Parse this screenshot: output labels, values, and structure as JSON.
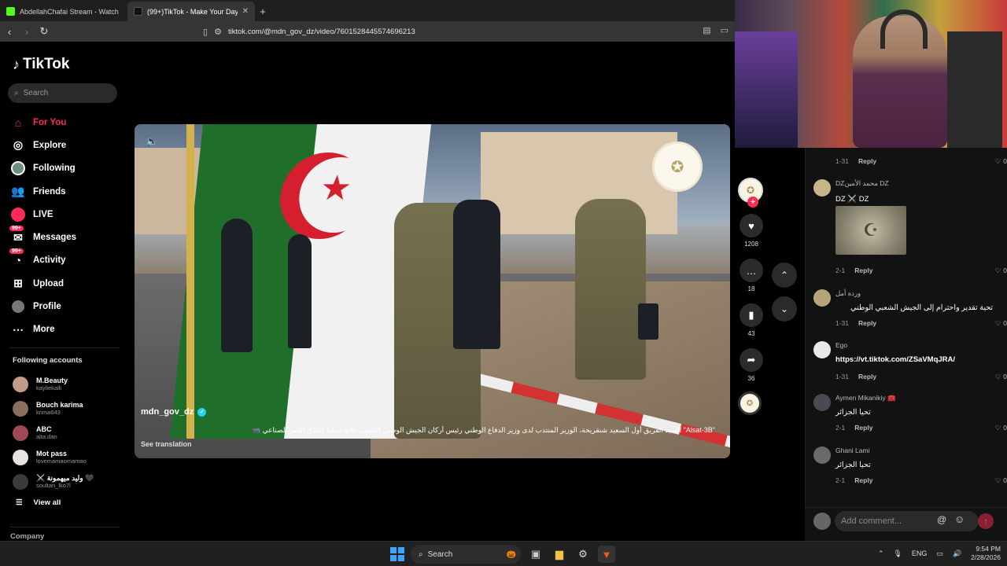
{
  "browser": {
    "tabs": [
      {
        "title": "AbdellahChafai Stream - Watch Live...",
        "active": false,
        "favicon_color": "#53fc18"
      },
      {
        "title": "(99+)TikTok - Make Your Day",
        "active": true,
        "favicon_color": "#000000"
      }
    ],
    "url": "tiktok.com/@mdn_gov_dz/video/7601528445574696213"
  },
  "sidebar": {
    "logo": "TikTok",
    "search_placeholder": "Search",
    "nav": [
      {
        "label": "For You",
        "icon": "home-icon",
        "active": true
      },
      {
        "label": "Explore",
        "icon": "compass-icon",
        "active": false
      },
      {
        "label": "Following",
        "icon": "following-avatar-icon",
        "active": false
      },
      {
        "label": "Friends",
        "icon": "friends-icon",
        "active": false
      },
      {
        "label": "LIVE",
        "icon": "live-icon",
        "active": false
      },
      {
        "label": "Messages",
        "icon": "messages-icon",
        "badge": "99+",
        "active": false
      },
      {
        "label": "Activity",
        "icon": "activity-icon",
        "badge": "99+",
        "active": false
      },
      {
        "label": "Upload",
        "icon": "upload-icon",
        "active": false
      },
      {
        "label": "Profile",
        "icon": "profile-icon",
        "active": false
      },
      {
        "label": "More",
        "icon": "more-icon",
        "active": false
      }
    ],
    "following_title": "Following accounts",
    "accounts": [
      {
        "name": "M.Beauty",
        "handle": "kayliekalli",
        "color": "#c49a8a"
      },
      {
        "name": "Bouch karima",
        "handle": "krima643",
        "color": "#8a6d5a"
      },
      {
        "name": "ABC",
        "handle": "alta.dan",
        "color": "#9e4a55"
      },
      {
        "name": "Mot pass",
        "handle": "lovemamaomamao",
        "color": "#e8e3dc"
      },
      {
        "name": "⚔️ وليد ميهمونة 🖤",
        "handle": "soultan_lko7l",
        "color": "#3b3b3b"
      }
    ],
    "view_all": "View all",
    "company": "Company"
  },
  "video": {
    "username": "mdn_gov_dz",
    "caption": "\"Alsat-3B\" السيد الفريق أول السعيد شنقريحة، الوزير المنتدب لدى وزير الدفاع الوطني رئيس أركان الجيش الوطني الشعبي يتابع عملية إطلاق القمر الصناعي 📹",
    "see_translation": "See translation"
  },
  "actions": {
    "likes": "1208",
    "comments": "18",
    "saves": "43",
    "shares": "36"
  },
  "comments": [
    {
      "name": "",
      "text": "",
      "date": "1-31",
      "reply": "Reply",
      "likes": "0",
      "color": "#555"
    },
    {
      "name": "DZمحمد الأمين DZ",
      "text": "DZ ⚔️ DZ",
      "date": "2-1",
      "reply": "Reply",
      "likes": "0",
      "color": "#c7b58a",
      "sticker": true
    },
    {
      "name": "وردة أمل",
      "text": "تحية تقدير واحترام إلى الجيش الشعبي الوطني",
      "date": "1-31",
      "reply": "Reply",
      "likes": "0",
      "color": "#b6a47a",
      "rtl": true
    },
    {
      "name": "Ego",
      "text": "https://vt.tiktok.com/ZSaVMqJRA/",
      "date": "1-31",
      "reply": "Reply",
      "likes": "0",
      "color": "#e8e8e8",
      "link": true
    },
    {
      "name": "Aymen Mikanikiy 🧰",
      "text": "تحيا الجزائر",
      "date": "2-1",
      "reply": "Reply",
      "likes": "0",
      "color": "#4a4a55",
      "rtl": true
    },
    {
      "name": "Ghani Lami",
      "text": "تحيا الجزائر",
      "date": "2-1",
      "reply": "Reply",
      "likes": "0",
      "color": "#6a6a6a",
      "rtl": true
    }
  ],
  "add_comment_placeholder": "Add comment...",
  "taskbar": {
    "search": "Search",
    "lang": "ENG",
    "time": "9:54 PM",
    "date": "2/28/2026"
  }
}
